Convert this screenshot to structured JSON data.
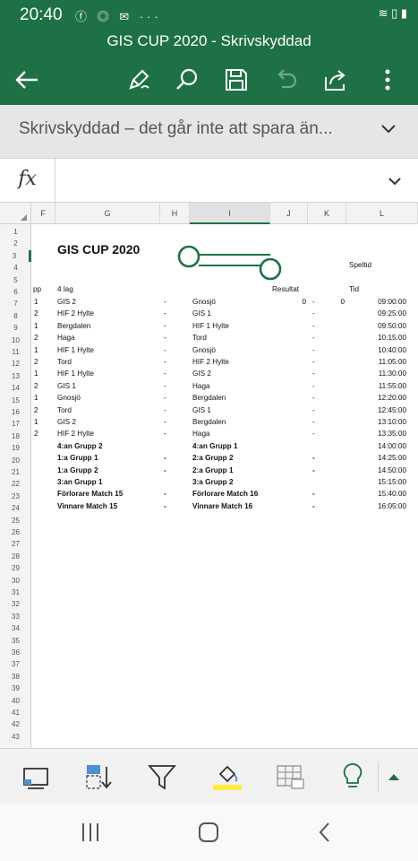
{
  "status": {
    "time": "20:40",
    "left_icons": "ⓕ ◎ ✉ ···",
    "right_icons": "≋ ▯ ▮"
  },
  "app": {
    "title": "GIS CUP 2020 - Skrivskyddad"
  },
  "colors": {
    "accent": "#1e7145",
    "highlight": "#ffeb3b"
  },
  "toolbar": {
    "icons": [
      "back-arrow-icon",
      "pen-icon",
      "search-icon",
      "save-icon",
      "undo-icon",
      "share-icon",
      "more-icon"
    ]
  },
  "message": {
    "text": "Skrivskyddad – det går inte att spara än..."
  },
  "formula": {
    "label": "fx",
    "value": ""
  },
  "columns": [
    "F",
    "G",
    "H",
    "I",
    "J",
    "K",
    "L"
  ],
  "selected_column": "I",
  "selected_row": "3",
  "rows": [
    "1",
    "2",
    "3",
    "4",
    "5",
    "6",
    "7",
    "8",
    "9",
    "10",
    "11",
    "12",
    "13",
    "14",
    "15",
    "16",
    "17",
    "18",
    "19",
    "20",
    "21",
    "22",
    "23",
    "24",
    "25",
    "26",
    "27",
    "28",
    "29",
    "30",
    "31",
    "32",
    "33",
    "34",
    "35",
    "36",
    "37",
    "38",
    "39",
    "40",
    "41",
    "42",
    "43"
  ],
  "sheet": {
    "title": "GIS CUP 2020",
    "speltid": "Speltid",
    "hdr_pp": "pp",
    "hdr_lag": "4 lag",
    "hdr_resultat": "Resultat",
    "hdr_tid": "Tid",
    "matches": [
      {
        "f": "1",
        "home": "GIS 2",
        "dash": "-",
        "away": "Gnosjö",
        "r1": "0",
        "r2": "0",
        "time": "09:00:00",
        "bold": false
      },
      {
        "f": "2",
        "home": "HIF 2 Hylte",
        "dash": "-",
        "away": "GIS 1",
        "r1": "",
        "r2": "",
        "time": "09:25:00",
        "bold": false
      },
      {
        "f": "1",
        "home": "Bergdalen",
        "dash": "-",
        "away": "HIF 1 Hylte",
        "r1": "",
        "r2": "",
        "time": "09:50:00",
        "bold": false
      },
      {
        "f": "2",
        "home": "Haga",
        "dash": "-",
        "away": "Tord",
        "r1": "",
        "r2": "",
        "time": "10:15:00",
        "bold": false
      },
      {
        "f": "1",
        "home": "HIF 1 Hylte",
        "dash": "-",
        "away": "Gnosjö",
        "r1": "",
        "r2": "",
        "time": "10:40:00",
        "bold": false
      },
      {
        "f": "2",
        "home": "Tord",
        "dash": "-",
        "away": "HIF 2 Hylte",
        "r1": "",
        "r2": "",
        "time": "11:05:00",
        "bold": false
      },
      {
        "f": "1",
        "home": "HIF 1 Hylte",
        "dash": "-",
        "away": "GIS 2",
        "r1": "",
        "r2": "",
        "time": "11:30:00",
        "bold": false
      },
      {
        "f": "2",
        "home": "GIS 1",
        "dash": "-",
        "away": "Haga",
        "r1": "",
        "r2": "",
        "time": "11:55:00",
        "bold": false
      },
      {
        "f": "1",
        "home": "Gnosjö",
        "dash": "-",
        "away": "Bergdalen",
        "r1": "",
        "r2": "",
        "time": "12:20:00",
        "bold": false
      },
      {
        "f": "2",
        "home": "Tord",
        "dash": "-",
        "away": "GIS 1",
        "r1": "",
        "r2": "",
        "time": "12:45:00",
        "bold": false
      },
      {
        "f": "1",
        "home": "GIS 2",
        "dash": "-",
        "away": "Bergdalen",
        "r1": "",
        "r2": "",
        "time": "13:10:00",
        "bold": false
      },
      {
        "f": "2",
        "home": "HIF 2 Hylte",
        "dash": "-",
        "away": "Haga",
        "r1": "",
        "r2": "",
        "time": "13:35:00",
        "bold": false
      },
      {
        "f": "",
        "home": "4:an Grupp 2",
        "dash": "",
        "away": "4:an Grupp 1",
        "r1": "",
        "r2": "",
        "time": "14:00:00",
        "bold": true
      },
      {
        "f": "",
        "home": "1:a Grupp 1",
        "dash": "-",
        "away": "2:a Grupp 2",
        "r1": "",
        "r2": "",
        "time": "14:25:00",
        "bold": true
      },
      {
        "f": "",
        "home": "1:a Grupp 2",
        "dash": "-",
        "away": "2:a Grupp 1",
        "r1": "",
        "r2": "",
        "time": "14:50:00",
        "bold": true
      },
      {
        "f": "",
        "home": "3:an Grupp 1",
        "dash": "",
        "away": "3:a Grupp 2",
        "r1": "",
        "r2": "",
        "time": "15:15:00",
        "bold": true
      },
      {
        "f": "",
        "home": "Förlorare Match 15",
        "dash": "-",
        "away": "Förlorare Match 16",
        "r1": "",
        "r2": "",
        "time": "15:40:00",
        "bold": true
      },
      {
        "f": "",
        "home": "Vinnare Match 15",
        "dash": "-",
        "away": "Vinnare Match 16",
        "r1": "",
        "r2": "",
        "time": "16:05:00",
        "bold": true
      }
    ]
  },
  "bottom": {
    "icons": [
      "sheet-view-icon",
      "sort-icon",
      "filter-icon",
      "fill-color-icon",
      "table-camera-icon",
      "idea-bulb-icon",
      "expand-up-icon"
    ]
  },
  "nav": {
    "icons": [
      "recent-apps-icon",
      "home-icon",
      "back-icon"
    ]
  }
}
